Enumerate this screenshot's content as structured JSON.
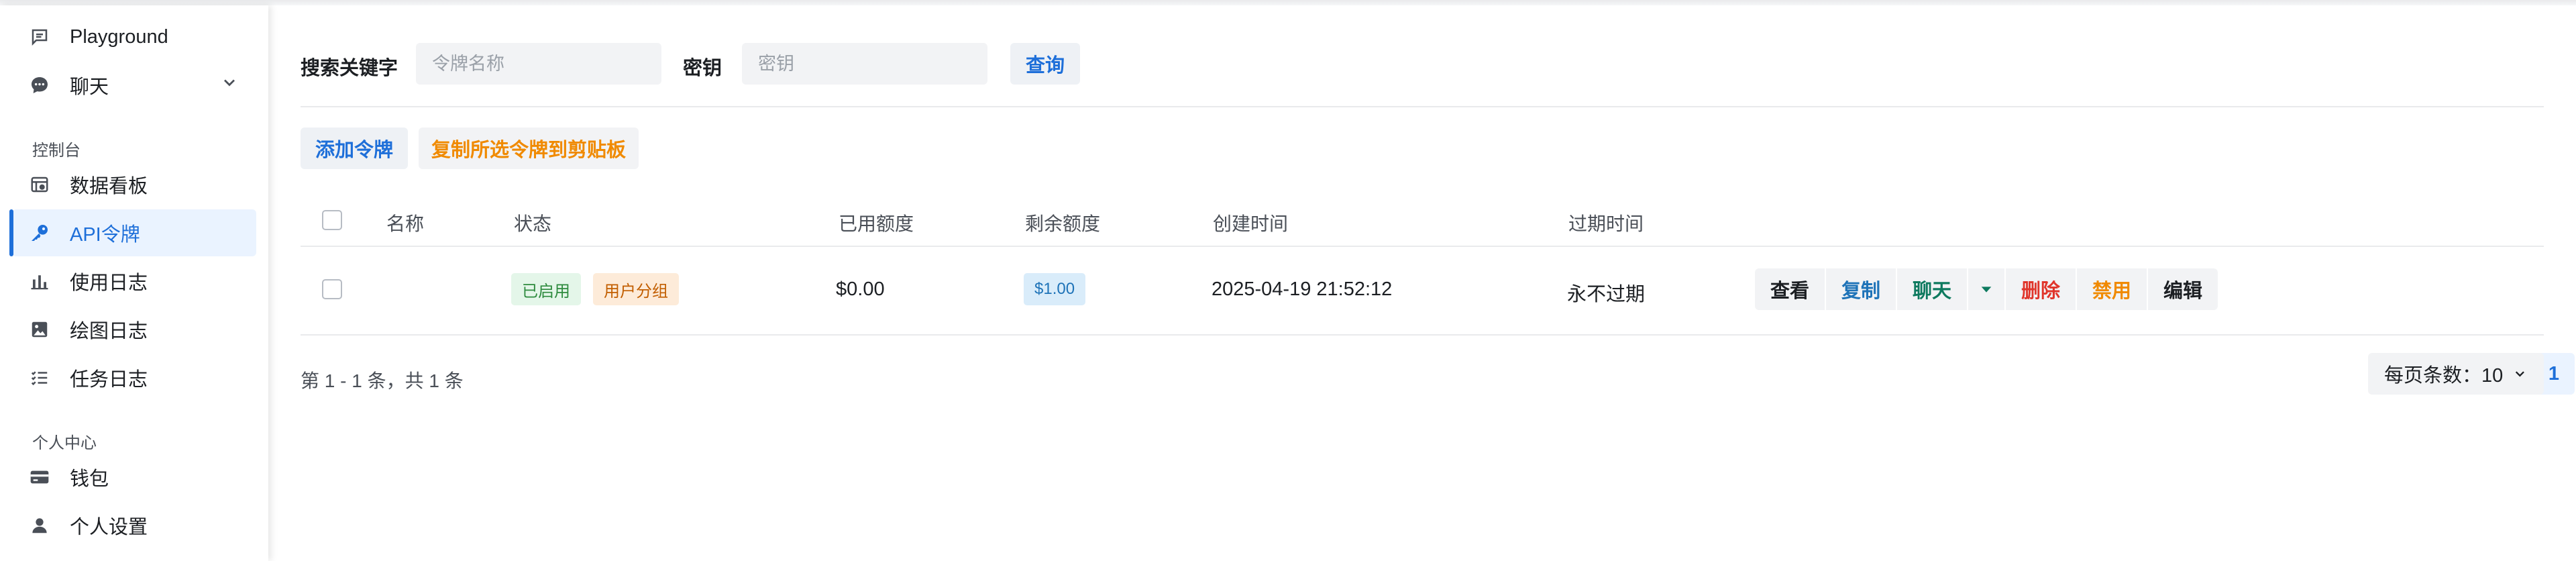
{
  "sidebar": {
    "items_top": [
      {
        "label": "Playground",
        "icon": "message-square-icon"
      },
      {
        "label": "聊天",
        "icon": "chat-bubble-icon",
        "expandable": true
      }
    ],
    "section_console": "控制台",
    "items_console": [
      {
        "label": "数据看板",
        "icon": "dashboard-icon"
      },
      {
        "label": "API令牌",
        "icon": "key-icon",
        "active": true
      },
      {
        "label": "使用日志",
        "icon": "bar-chart-icon"
      },
      {
        "label": "绘图日志",
        "icon": "image-icon"
      },
      {
        "label": "任务日志",
        "icon": "task-list-icon"
      }
    ],
    "section_personal": "个人中心",
    "items_personal": [
      {
        "label": "钱包",
        "icon": "wallet-icon"
      },
      {
        "label": "个人设置",
        "icon": "user-icon"
      }
    ]
  },
  "search": {
    "keyword_label": "搜索关键字",
    "keyword_placeholder": "令牌名称",
    "keyword_value": "",
    "key_label": "密钥",
    "key_placeholder": "密钥",
    "key_value": "",
    "query_button": "查询"
  },
  "toolbar": {
    "add_token": "添加令牌",
    "copy_selected": "复制所选令牌到剪贴板"
  },
  "table": {
    "columns": [
      "名称",
      "状态",
      "已用额度",
      "剩余额度",
      "创建时间",
      "过期时间"
    ],
    "rows": [
      {
        "name": "",
        "status": "已启用",
        "group": "用户分组",
        "used_quota": "$0.00",
        "remaining_quota": "$1.00",
        "created_time": "2025-04-19 21:52:12",
        "expire_time": "永不过期",
        "actions": [
          "查看",
          "复制",
          "聊天",
          "删除",
          "禁用",
          "编辑"
        ]
      }
    ]
  },
  "pagination": {
    "summary": "第 1 - 1 条，共 1 条",
    "current_page": "1",
    "page_size_label": "每页条数：10"
  },
  "colors": {
    "accent": "#1e6fd9",
    "orange": "#f08a00",
    "danger": "#e0352b",
    "teal": "#0e7a5f"
  }
}
